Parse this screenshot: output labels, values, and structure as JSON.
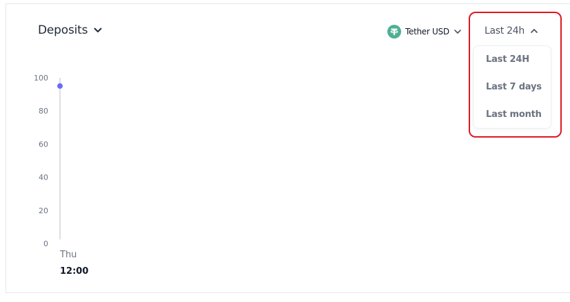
{
  "header": {
    "title": "Deposits"
  },
  "asset_selector": {
    "label": "Tether USD",
    "icon": "tether-icon",
    "icon_color": "#50af95"
  },
  "range_selector": {
    "label": "Last 24h",
    "expanded": true,
    "options": [
      {
        "label": "Last 24H"
      },
      {
        "label": "Last 7 days"
      },
      {
        "label": "Last month"
      }
    ]
  },
  "colors": {
    "highlight": "#e0151f",
    "series": "#6d6af5"
  },
  "chart_data": {
    "type": "line",
    "x": [
      {
        "day": "Thu",
        "time": "12:00"
      }
    ],
    "series": [
      {
        "values": [
          95
        ]
      }
    ],
    "ylim": [
      0,
      100
    ],
    "yticks": [
      0,
      20,
      40,
      60,
      80,
      100
    ],
    "grid": false,
    "legend": "none"
  }
}
